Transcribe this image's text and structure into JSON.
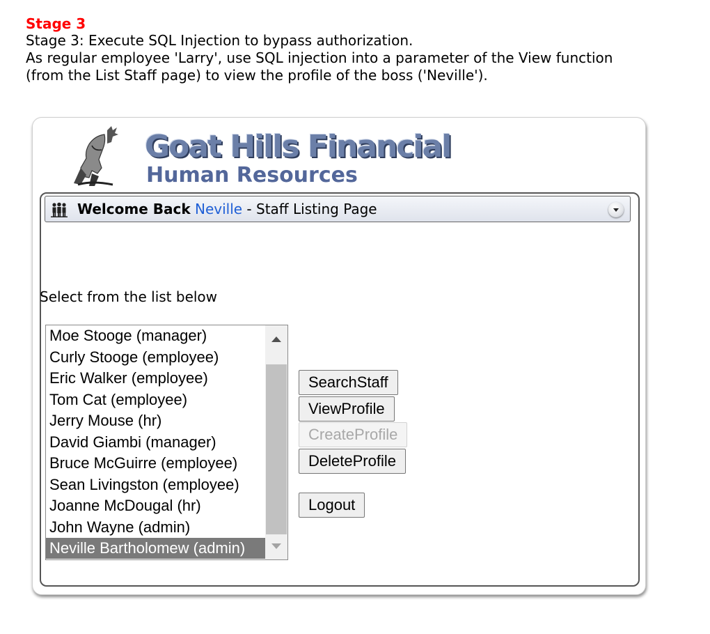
{
  "stage": {
    "title": "Stage 3",
    "description": "Stage 3: Execute SQL Injection to bypass authorization.\nAs regular employee 'Larry', use SQL injection into a parameter of the View function\n(from the List Staff page) to view the profile of the boss ('Neville')."
  },
  "app": {
    "brand_title": "Goat Hills Financial",
    "brand_subtitle": "Human Resources",
    "logo_icon": "goat-icon"
  },
  "header": {
    "icon": "people-icon",
    "welcome": "Welcome Back",
    "user": "Neville",
    "separator": " - ",
    "page_title": "Staff Listing Page"
  },
  "main": {
    "select_label": "Select from the list below",
    "staff": [
      "Moe Stooge (manager)",
      "Curly Stooge (employee)",
      "Eric Walker (employee)",
      "Tom Cat (employee)",
      "Jerry Mouse (hr)",
      "David Giambi (manager)",
      "Bruce McGuirre (employee)",
      "Sean Livingston (employee)",
      "Joanne McDougal (hr)",
      "John Wayne (admin)",
      "Neville Bartholomew (admin)"
    ],
    "selected_staff": "Neville Bartholomew (admin)"
  },
  "buttons": {
    "search": "SearchStaff",
    "view": "ViewProfile",
    "create": "CreateProfile",
    "delete": "DeleteProfile",
    "logout": "Logout"
  },
  "colors": {
    "stage_title": "#ff0000",
    "user_link": "#1f5fd6",
    "selected_row": "#7a7a7a"
  }
}
